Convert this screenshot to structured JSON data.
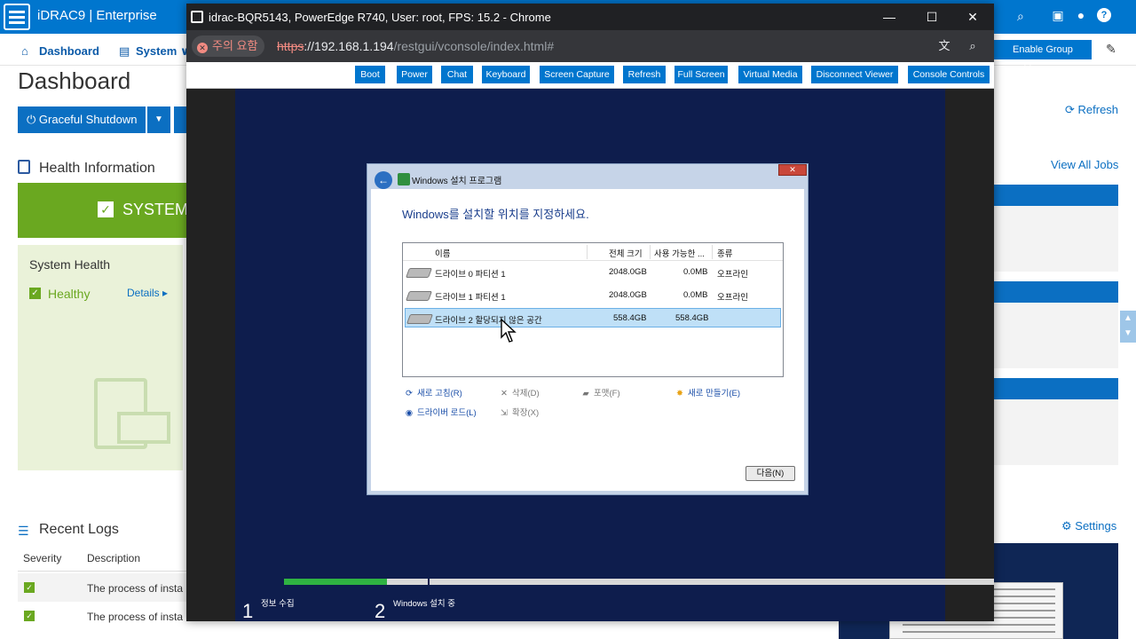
{
  "idrac": {
    "brand": "iDRAC9 | Enterprise",
    "nav": {
      "dashboard": "Dashboard",
      "system": "System ∨"
    },
    "enable_group_manager": "Enable Group Manager",
    "page_title": "Dashboard",
    "graceful_shutdown": "Graceful Shutdown",
    "health_information": "Health Information",
    "system_banner": "SYSTEM",
    "system_health": "System Health",
    "healthy": "Healthy",
    "details": "Details",
    "recent_logs": "Recent Logs",
    "log_columns": [
      "Severity",
      "Description"
    ],
    "log_rows": [
      "The process of insta",
      "The process of insta"
    ],
    "refresh": "Refresh",
    "view_all_jobs": "View All Jobs",
    "settings": "Settings"
  },
  "chrome": {
    "title": "idrac-BQR5143, PowerEdge R740, User: root, FPS: 15.2 - Chrome",
    "security_chip": "주의 요함",
    "url_scheme": "https",
    "url_host": "://192.168.1.194",
    "url_path": "/restgui/vconsole/index.html#"
  },
  "console_toolbar": [
    "Boot",
    "Power",
    "Chat",
    "Keyboard",
    "Screen Capture",
    "Refresh",
    "Full Screen",
    "Virtual Media",
    "Disconnect Viewer",
    "Console Controls"
  ],
  "setup": {
    "window_title": "Windows 설치 프로그램",
    "heading": "Windows를 설치할 위치를 지정하세요.",
    "columns": [
      "이름",
      "전체 크기",
      "사용 가능한 ...",
      "종류"
    ],
    "drives": [
      {
        "name": "드라이브 0 파티션 1",
        "total": "2048.0GB",
        "free": "0.0MB",
        "type": "오프라인"
      },
      {
        "name": "드라이브 1 파티션 1",
        "total": "2048.0GB",
        "free": "0.0MB",
        "type": "오프라인"
      },
      {
        "name": "드라이브 2 할당되지 않은 공간",
        "total": "558.4GB",
        "free": "558.4GB",
        "type": ""
      }
    ],
    "actions": {
      "refresh": "새로 고침(R)",
      "delete": "삭제(D)",
      "format": "포맷(F)",
      "new": "새로 만들기(E)",
      "load_driver": "드라이버 로드(L)",
      "extend": "확장(X)"
    },
    "next": "다음(N)",
    "steps": [
      {
        "num": "1",
        "label": "정보 수집"
      },
      {
        "num": "2",
        "label": "Windows 설치 중"
      }
    ],
    "progress": 0.145
  }
}
